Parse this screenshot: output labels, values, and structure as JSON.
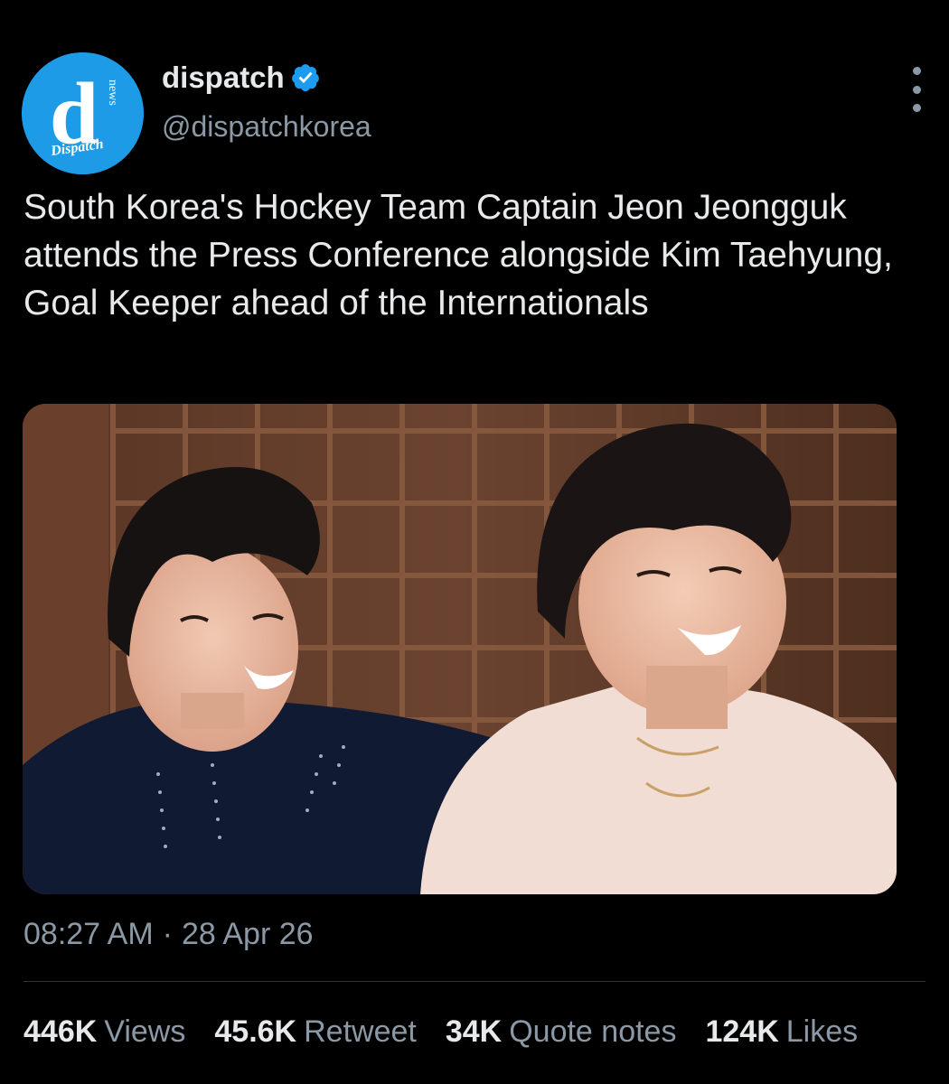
{
  "account": {
    "display_name": "dispatch",
    "handle": "@dispatchkorea",
    "verified_icon": "verified-badge-icon",
    "avatar_text": {
      "letter": "d",
      "vertical": "news",
      "script": "Dispatch"
    },
    "avatar_color": "#1da1f2"
  },
  "more_icon": "more-vertical-icon",
  "tweet": {
    "text": "South Korea's Hockey Team Captain Jeon Jeongguk attends the Press Conference alongside Kim Taehyung, Goal Keeper ahead of the Internationals"
  },
  "meta": {
    "time": "08:27 AM",
    "separator": "·",
    "date": "28 Apr 26"
  },
  "stats": [
    {
      "value": "446K",
      "label": "Views"
    },
    {
      "value": "45.6K",
      "label": "Retweet"
    },
    {
      "value": "34K",
      "label": "Quote notes"
    },
    {
      "value": "124K",
      "label": "Likes"
    }
  ],
  "colors": {
    "background": "#000000",
    "text_primary": "#e7e9ea",
    "text_secondary": "#8b98a5",
    "verified_blue": "#1d9bf0",
    "divider": "#2f3336"
  }
}
